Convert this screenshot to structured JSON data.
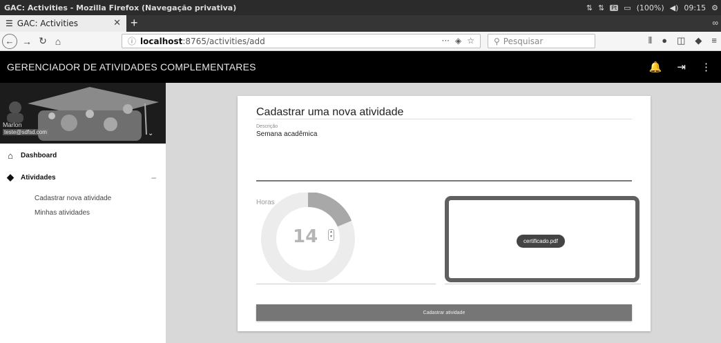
{
  "os": {
    "window_title": "GAC: Activities - Mozilla Firefox (Navegação privativa)",
    "battery": "(100%)",
    "time": "09:15",
    "lang": "Pt"
  },
  "browser": {
    "tab_title": "GAC: Activities",
    "url_host": "localhost",
    "url_rest": ":8765/activities/add",
    "search_placeholder": "Pesquisar"
  },
  "app": {
    "title": "GERENCIADOR DE ATIVIDADES COMPLEMENTARES"
  },
  "sidebar": {
    "user_name": "Marlon",
    "user_email": "teste@sdfsd.com",
    "items": [
      {
        "label": "Dashboard",
        "icon": "home-icon"
      },
      {
        "label": "Atividades",
        "icon": "tag-icon"
      }
    ],
    "sub_items": [
      {
        "label": "Cadastrar nova atividade"
      },
      {
        "label": "Minhas atividades"
      }
    ]
  },
  "form": {
    "title": "Cadastrar uma nova atividade",
    "desc_label": "Descrição",
    "desc_value": "Semana acadêmica",
    "horas_label": "Horas",
    "horas_value": "14",
    "file_name": "certificado.pdf",
    "submit_label": "Cadastrar atividade"
  },
  "colors": {
    "header_bg": "#000000",
    "accent_gray": "#767676"
  }
}
